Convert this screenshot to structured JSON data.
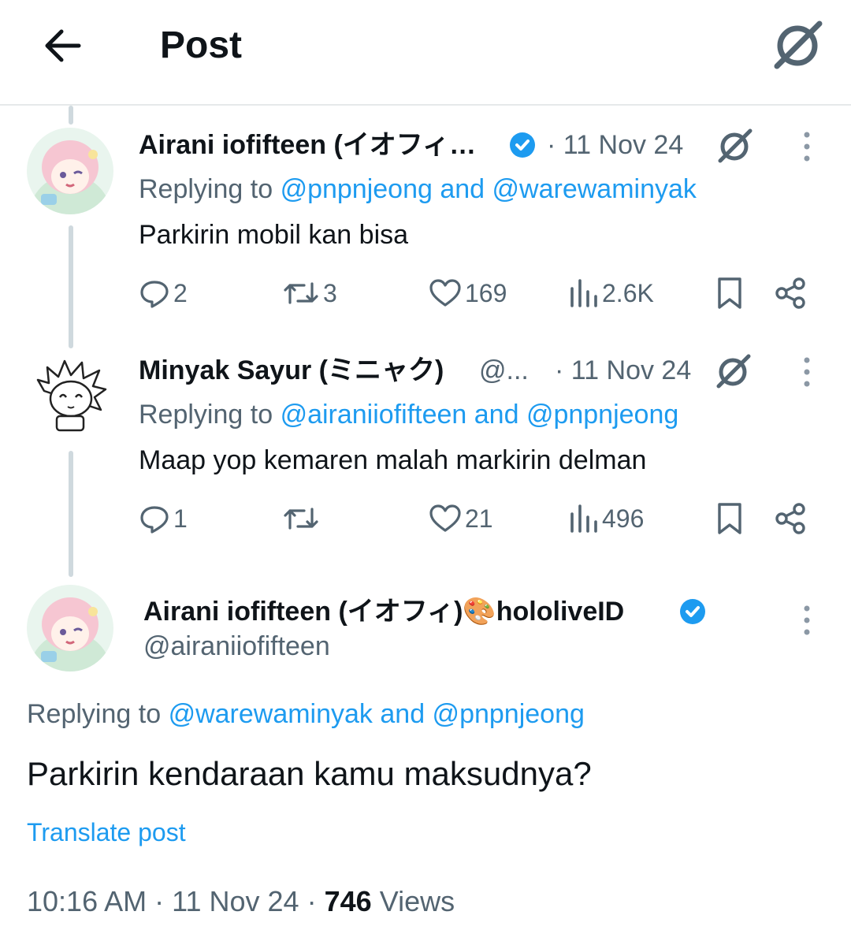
{
  "header": {
    "title": "Post"
  },
  "tweets": [
    {
      "name": "Airani iofifteen (イオフィ…",
      "date": "· 11 Nov 24",
      "replying_prefix": "Replying to",
      "replying_mentions": "@pnpnjeong and @warewaminyak",
      "text": "Parkirin mobil kan bisa",
      "replies": "2",
      "reposts": "3",
      "likes": "169",
      "views": "2.6K"
    },
    {
      "name": "Minyak Sayur (ミニャク)",
      "handle": "@...",
      "date": "· 11 Nov 24",
      "replying_prefix": "Replying to",
      "replying_mentions": "@airaniiofifteen and @pnpnjeong",
      "text": "Maap yop kemaren malah markirin delman",
      "replies": "1",
      "reposts": "",
      "likes": "21",
      "views": "496"
    }
  ],
  "main_post": {
    "name": "Airani iofifteen (イオフィ)🎨hololiveID",
    "handle": "@airaniiofifteen",
    "replying_prefix": "Replying to",
    "replying_mentions": "@warewaminyak and @pnpnjeong",
    "text": "Parkirin kendaraan kamu maksudnya?",
    "translate": "Translate post",
    "time": "10:16 AM",
    "date": "11 Nov 24",
    "views_count": "746",
    "views_label": "Views"
  },
  "colors": {
    "accent": "#1d9bf0",
    "secondary_text": "#536471",
    "thread_line": "#cfd9de"
  }
}
